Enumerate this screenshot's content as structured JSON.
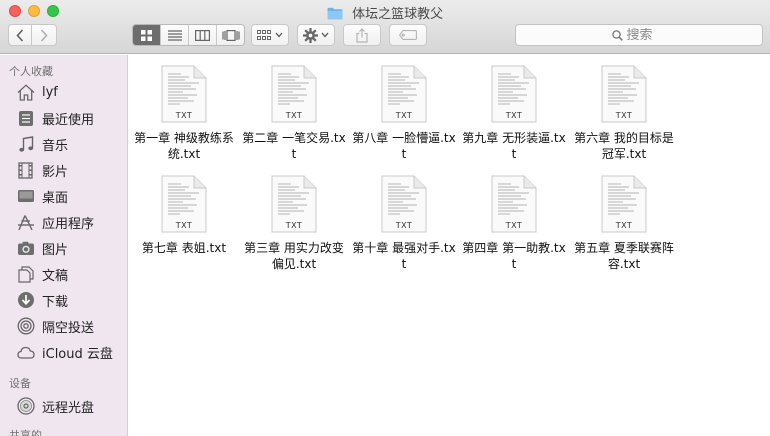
{
  "window": {
    "title": "体坛之篮球教父"
  },
  "toolbar": {
    "back_icon": "chevron-left-icon",
    "forward_icon": "chevron-right-icon",
    "view_modes": [
      "icon-view",
      "list-view",
      "column-view",
      "cover-flow-view"
    ],
    "arrange_icon": "arrange-grid-icon",
    "action_icon": "gear-icon",
    "share_icon": "share-icon",
    "tag_icon": "tag-icon"
  },
  "search": {
    "placeholder": "搜索",
    "value": ""
  },
  "sidebar": {
    "favorites_header": "个人收藏",
    "favorites": [
      {
        "label": "lyf",
        "icon": "home-icon"
      },
      {
        "label": "最近使用",
        "icon": "recents-icon"
      },
      {
        "label": "音乐",
        "icon": "music-icon"
      },
      {
        "label": "影片",
        "icon": "movies-icon"
      },
      {
        "label": "桌面",
        "icon": "desktop-icon"
      },
      {
        "label": "应用程序",
        "icon": "applications-icon"
      },
      {
        "label": "图片",
        "icon": "pictures-icon"
      },
      {
        "label": "文稿",
        "icon": "documents-icon"
      },
      {
        "label": "下载",
        "icon": "downloads-icon"
      },
      {
        "label": "隔空投送",
        "icon": "airdrop-icon"
      },
      {
        "label": "iCloud 云盘",
        "icon": "cloud-icon"
      }
    ],
    "devices_header": "设备",
    "devices": [
      {
        "label": "远程光盘",
        "icon": "disc-icon"
      }
    ],
    "shared_header": "共享的"
  },
  "files": [
    {
      "name": "第一章 神级教练系统.txt",
      "badge": "TXT"
    },
    {
      "name": "第二章 一笔交易.txt",
      "badge": "TXT"
    },
    {
      "name": "第八章 一脸懵逼.txt",
      "badge": "TXT"
    },
    {
      "name": "第九章 无形装逼.txt",
      "badge": "TXT"
    },
    {
      "name": "第六章 我的目标是冠军.txt",
      "badge": "TXT"
    },
    {
      "name": "第七章 表姐.txt",
      "badge": "TXT"
    },
    {
      "name": "第三章 用实力改变偏见.txt",
      "badge": "TXT"
    },
    {
      "name": "第十章 最强对手.txt",
      "badge": "TXT"
    },
    {
      "name": "第四章 第一助教.txt",
      "badge": "TXT"
    },
    {
      "name": "第五章 夏季联赛阵容.txt",
      "badge": "TXT"
    }
  ]
}
